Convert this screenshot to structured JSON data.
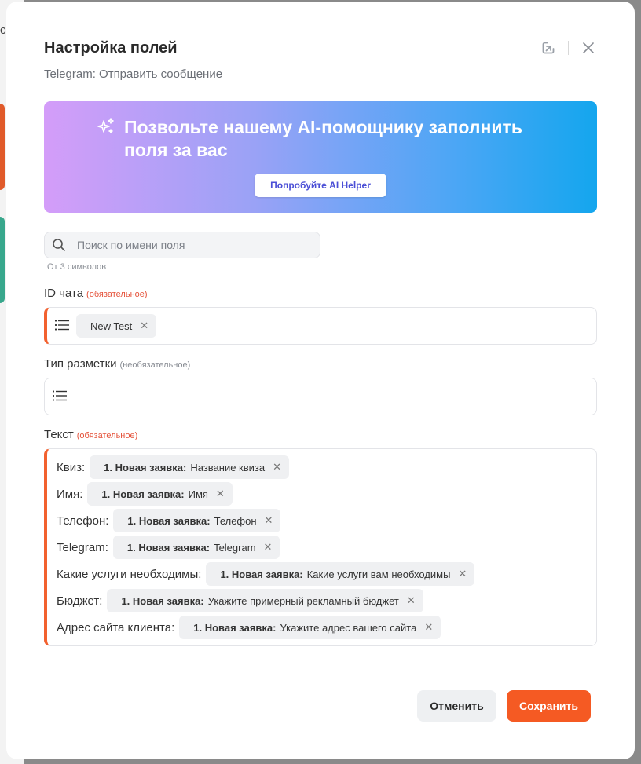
{
  "background": {
    "letter": "c"
  },
  "modal": {
    "title": "Настройка полей",
    "subtitle": "Telegram: Отправить сообщение",
    "icons": [
      "open-external-icon",
      "close-icon"
    ]
  },
  "ai_banner": {
    "text": "Позвольте нашему AI-помощнику заполнить поля за вас",
    "button": "Попробуйте AI Helper"
  },
  "search": {
    "placeholder": "Поиск по имени поля",
    "hint": "От 3 символов"
  },
  "fields": {
    "chat_id": {
      "label": "ID чата",
      "tag": "(обязательное)",
      "chips": [
        {
          "text": "New Test"
        }
      ]
    },
    "markup": {
      "label": "Тип разметки",
      "tag": "(необязательное)"
    },
    "text": {
      "label": "Текст",
      "tag": "(обязательное)",
      "rows": [
        {
          "label": "Квиз:",
          "source": "1. Новая заявка:",
          "value": "Название квиза"
        },
        {
          "label": "Имя:",
          "source": "1. Новая заявка:",
          "value": "Имя"
        },
        {
          "label": "Телефон:",
          "source": "1. Новая заявка:",
          "value": "Телефон"
        },
        {
          "label": "Telegram:",
          "source": "1. Новая заявка:",
          "value": "Telegram"
        },
        {
          "label": "Какие услуги необходимы:",
          "source": "1. Новая заявка:",
          "value": "Какие услуги вам необходимы"
        },
        {
          "label": "Бюджет:",
          "source": "1. Новая заявка:",
          "value": "Укажите примерный рекламный бюджет"
        },
        {
          "label": "Адрес сайта клиента:",
          "source": "1. Новая заявка:",
          "value": "Укажите адрес вашего сайта"
        }
      ]
    }
  },
  "footer": {
    "cancel": "Отменить",
    "save": "Сохранить"
  },
  "colors": {
    "accent": "#f55a23",
    "required": "#e5533b",
    "banner_start": "#d49df9",
    "banner_end": "#14a6ee"
  }
}
